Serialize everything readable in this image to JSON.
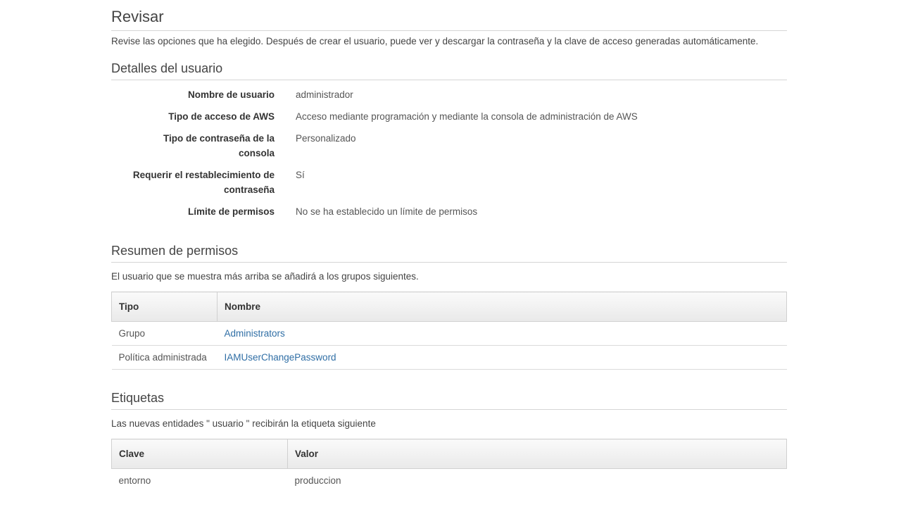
{
  "header": {
    "title": "Revisar",
    "intro": "Revise las opciones que ha elegido. Después de crear el usuario, puede ver y descargar la contraseña y la clave de acceso generadas automáticamente."
  },
  "user_details": {
    "title": "Detalles del usuario",
    "rows": [
      {
        "label": "Nombre de usuario",
        "value": "administrador"
      },
      {
        "label": "Tipo de acceso de AWS",
        "value": "Acceso mediante programación y mediante la consola de administración de AWS"
      },
      {
        "label_line1": "Tipo de contraseña de la",
        "label_line2": "consola",
        "value": "Personalizado"
      },
      {
        "label_line1": "Requerir el restablecimiento de",
        "label_line2": "contraseña",
        "value": "Sí"
      },
      {
        "label": "Límite de permisos",
        "value": "No se ha establecido un límite de permisos"
      }
    ]
  },
  "permissions": {
    "title": "Resumen de permisos",
    "description": "El usuario que se muestra más arriba se añadirá a los grupos siguientes.",
    "columns": [
      "Tipo",
      "Nombre"
    ],
    "rows": [
      {
        "type": "Grupo",
        "name": "Administrators"
      },
      {
        "type": "Política administrada",
        "name": "IAMUserChangePassword"
      }
    ]
  },
  "tags": {
    "title": "Etiquetas",
    "description": "Las nuevas entidades \" usuario \" recibirán la etiqueta siguiente",
    "columns": [
      "Clave",
      "Valor"
    ],
    "rows": [
      {
        "key": "entorno",
        "value": "produccion"
      }
    ]
  }
}
